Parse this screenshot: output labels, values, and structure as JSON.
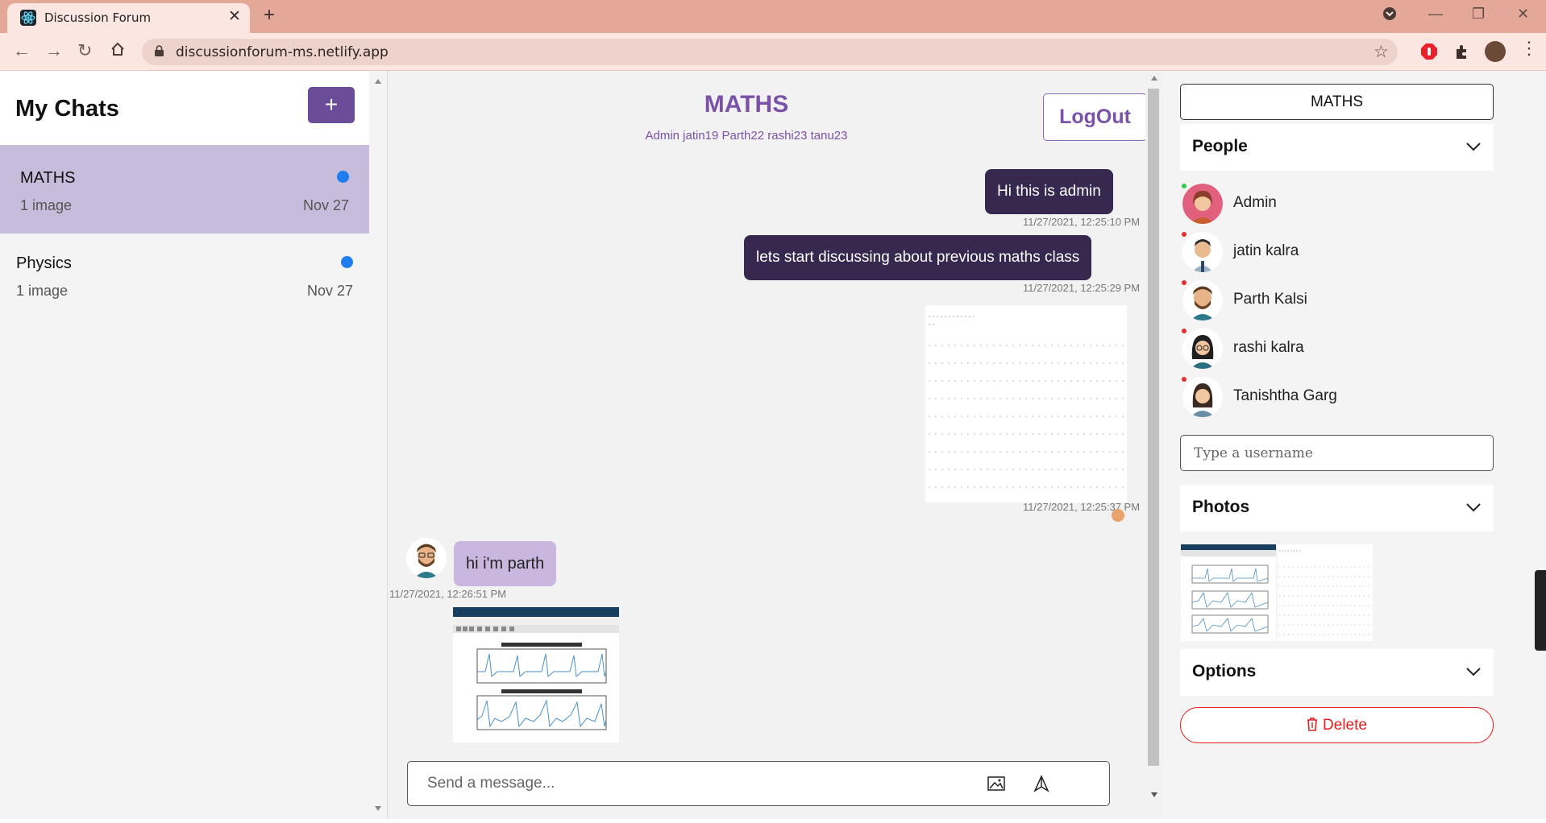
{
  "browser": {
    "tab_title": "Discussion Forum",
    "url": "discussionforum-ms.netlify.app"
  },
  "sidebar": {
    "title": "My Chats",
    "add_label": "+",
    "chats": [
      {
        "name": "MATHS",
        "last_message": "1 image",
        "date": "Nov 27"
      },
      {
        "name": "Physics",
        "last_message": "1 image",
        "date": "Nov 27"
      }
    ]
  },
  "chat": {
    "title": "MATHS",
    "members": "Admin jatin19 Parth22 rashi23 tanu23",
    "logout_label": "LogOut",
    "messages": [
      {
        "text": "Hi this is admin",
        "time": "11/27/2021, 12:25:10 PM"
      },
      {
        "text": "lets start discussing about previous maths class",
        "time": "11/27/2021, 12:25:29 PM"
      },
      {
        "text": "",
        "time": "11/27/2021, 12:25:37 PM"
      },
      {
        "text": "hi i'm parth",
        "time": "11/27/2021, 12:26:51 PM"
      }
    ],
    "input_placeholder": "Send a message..."
  },
  "details": {
    "chat_name": "MATHS",
    "people_label": "People",
    "people": [
      {
        "name": "Admin",
        "status_color": "#2ecc40"
      },
      {
        "name": "jatin kalra",
        "status_color": "#e03030"
      },
      {
        "name": "Parth Kalsi",
        "status_color": "#e03030"
      },
      {
        "name": "rashi kalra",
        "status_color": "#e03030"
      },
      {
        "name": "Tanishtha Garg",
        "status_color": "#e03030"
      }
    ],
    "username_placeholder": "Type a username",
    "photos_label": "Photos",
    "options_label": "Options",
    "delete_label": "Delete"
  },
  "colors": {
    "accent": "#6a4c99",
    "bubble_out": "#36284f",
    "bubble_in": "#c9b7e0",
    "unread": "#1f7df0",
    "danger": "#e02020"
  }
}
